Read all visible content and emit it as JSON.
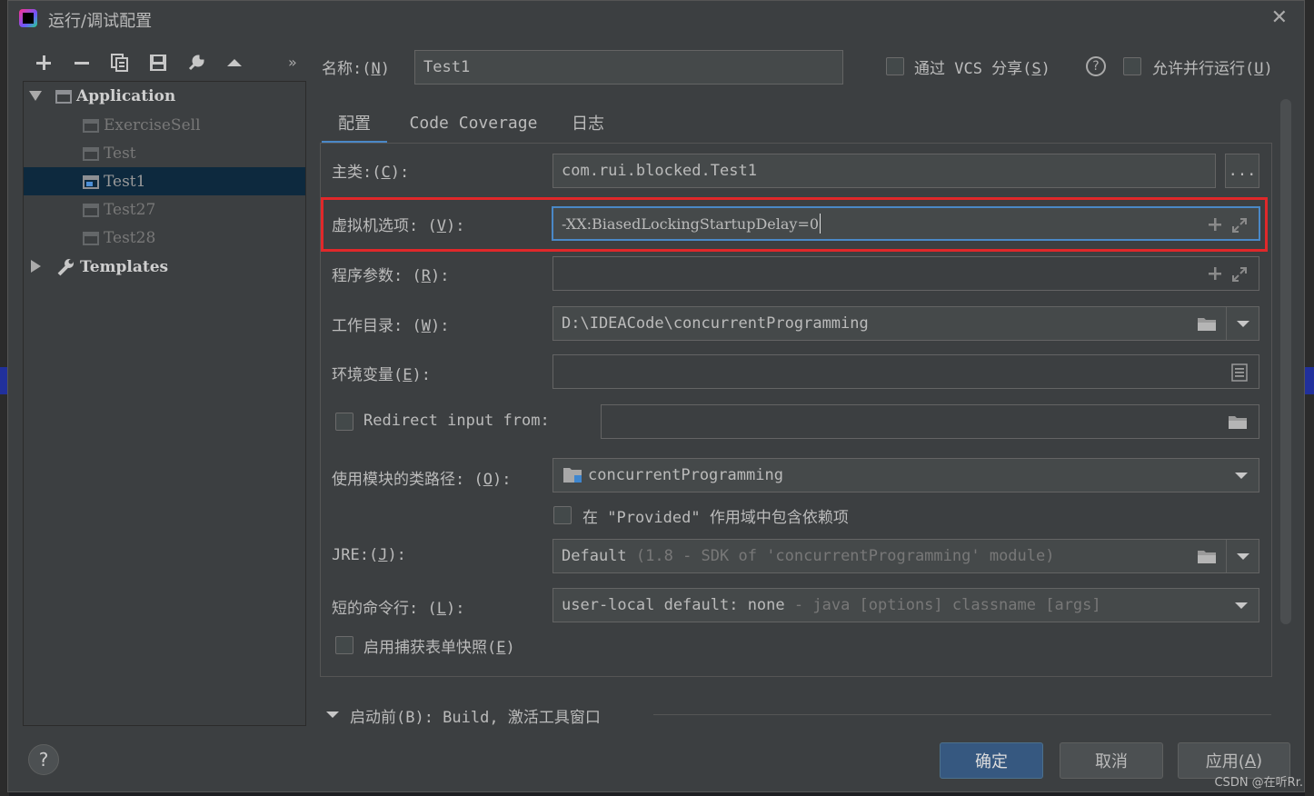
{
  "window": {
    "title": "运行/调试配置"
  },
  "toolbar": {
    "more": "»"
  },
  "tree": {
    "items": [
      {
        "label": "Application"
      },
      {
        "label": "ExerciseSell"
      },
      {
        "label": "Test"
      },
      {
        "label": "Test1"
      },
      {
        "label": "Test27"
      },
      {
        "label": "Test28"
      },
      {
        "label": "Templates"
      }
    ]
  },
  "header": {
    "name_label": "名称:(",
    "name_mnemonic": "N",
    "name_close": ")",
    "name_value": "Test1",
    "vcs_label_pre": "通过 VCS 分享(",
    "vcs_mnemonic": "S",
    "vcs_close": ")",
    "help": "?",
    "parallel_pre": "允许并行运行(",
    "parallel_mnemonic": "U",
    "parallel_close": ")"
  },
  "tabs": [
    {
      "label": "配置"
    },
    {
      "label": "Code Coverage"
    },
    {
      "label": "日志"
    }
  ],
  "form": {
    "main_class": {
      "label": "主类:(",
      "mnemonic": "C",
      "close": "):",
      "value": "com.rui.blocked.Test1",
      "button": "..."
    },
    "vm_options": {
      "label": "虚拟机选项: (",
      "mnemonic": "V",
      "close": "):",
      "value": "-XX:BiasedLockingStartupDelay=0"
    },
    "program_args": {
      "label": "程序参数: (",
      "mnemonic": "R",
      "close": "):",
      "value": ""
    },
    "workdir": {
      "label": "工作目录: (",
      "mnemonic": "W",
      "close": "):",
      "value": "D:\\IDEACode\\concurrentProgramming"
    },
    "env": {
      "label": "环境变量(",
      "mnemonic": "E",
      "close": "):",
      "value": ""
    },
    "redirect": {
      "label": "Redirect input from:",
      "value": ""
    },
    "classpath": {
      "label": "使用模块的类路径: (",
      "mnemonic": "O",
      "close": "):",
      "value": "concurrentProgramming"
    },
    "provided": {
      "label": "在 \"Provided\" 作用域中包含依赖项"
    },
    "jre": {
      "label": "JRE:(",
      "mnemonic": "J",
      "close": "):",
      "value": "Default",
      "hint": "(1.8 - SDK of 'concurrentProgramming' module)"
    },
    "shorten": {
      "label": "短的命令行: (",
      "mnemonic": "L",
      "close": "):",
      "value": "user-local default: none",
      "hint": "- java [options] classname [args]"
    },
    "snapshot": {
      "label_pre": "启用捕获表单快照(",
      "mnemonic": "E",
      "close": ")"
    }
  },
  "before_launch": {
    "label": "启动前(B): Build, 激活工具窗口"
  },
  "buttons": {
    "ok": "确定",
    "cancel": "取消",
    "apply_pre": "应用(",
    "apply_mnemonic": "A",
    "apply_close": ")",
    "help": "?"
  },
  "watermark": "CSDN @在听Rr."
}
